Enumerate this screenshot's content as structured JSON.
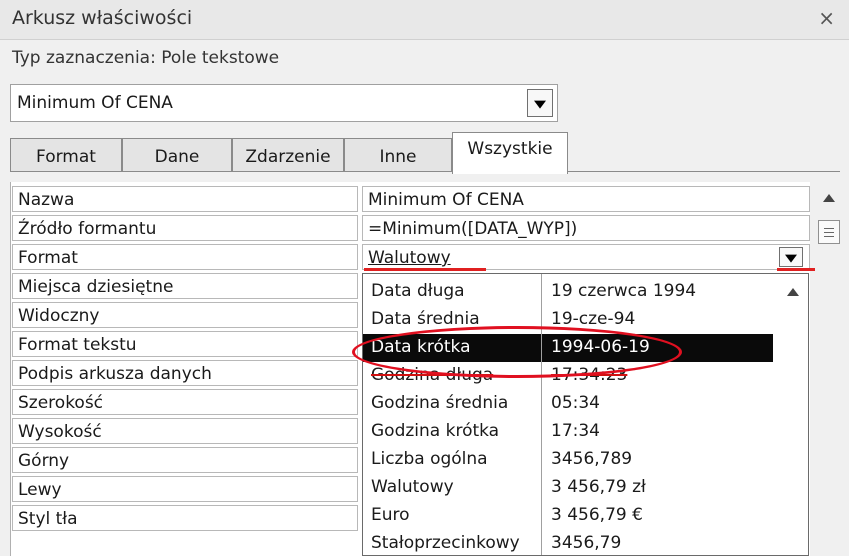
{
  "window": {
    "title": "Arkusz właściwości",
    "close_icon": "×",
    "selection_type": "Typ zaznaczenia: Pole tekstowe"
  },
  "combo": {
    "value": "Minimum Of CENA"
  },
  "tabs": [
    {
      "label": "Format",
      "active": false
    },
    {
      "label": "Dane",
      "active": false
    },
    {
      "label": "Zdarzenie",
      "active": false
    },
    {
      "label": "Inne",
      "active": false
    },
    {
      "label": "Wszystkie",
      "active": true
    }
  ],
  "properties": [
    {
      "name": "Nazwa",
      "value": "Minimum Of CENA"
    },
    {
      "name": "Źródło formantu",
      "value": "=Minimum([DATA_WYP])"
    },
    {
      "name": "Format",
      "value": "Walutowy"
    },
    {
      "name": "Miejsca dziesiętne",
      "value": ""
    },
    {
      "name": "Widoczny",
      "value": ""
    },
    {
      "name": "Format tekstu",
      "value": ""
    },
    {
      "name": "Podpis arkusza danych",
      "value": ""
    },
    {
      "name": "Szerokość",
      "value": ""
    },
    {
      "name": "Wysokość",
      "value": ""
    },
    {
      "name": "Górny",
      "value": ""
    },
    {
      "name": "Lewy",
      "value": ""
    },
    {
      "name": "Styl tła",
      "value": ""
    }
  ],
  "dropdown": {
    "selected_index": 2,
    "items": [
      {
        "name": "Data długa",
        "example": "19 czerwca 1994"
      },
      {
        "name": "Data średnia",
        "example": "19-cze-94"
      },
      {
        "name": "Data krótka",
        "example": "1994-06-19"
      },
      {
        "name": "Godzina długa",
        "example": "17:34:23"
      },
      {
        "name": "Godzina średnia",
        "example": "05:34"
      },
      {
        "name": "Godzina krótka",
        "example": "17:34"
      },
      {
        "name": "Liczba ogólna",
        "example": "3456,789"
      },
      {
        "name": "Walutowy",
        "example": "3 456,79 zł"
      },
      {
        "name": "Euro",
        "example": "3 456,79 €"
      },
      {
        "name": "Stałoprzecinkowy",
        "example": "3456,79"
      }
    ]
  },
  "colors": {
    "annotation_red": "#e01020",
    "selected_row_bg": "#0a0a0a"
  }
}
